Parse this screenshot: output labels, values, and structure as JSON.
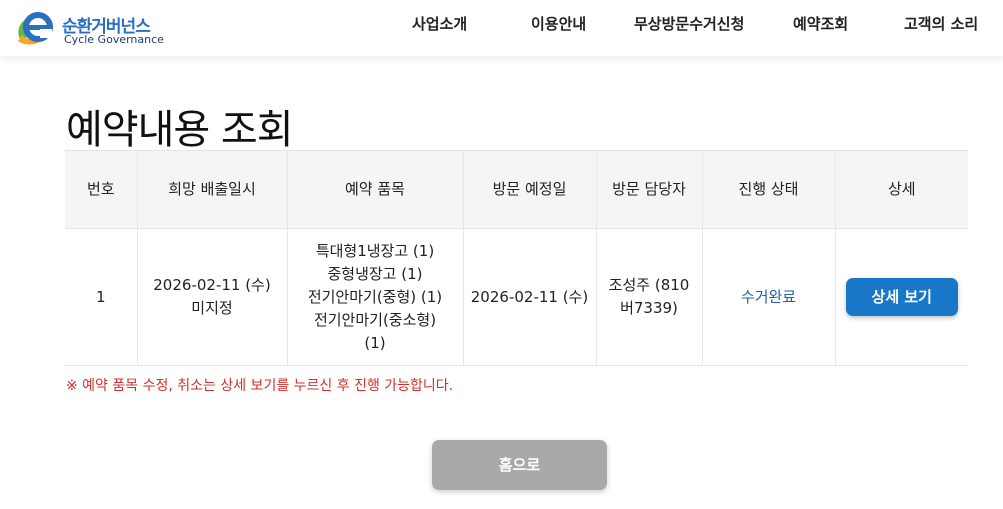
{
  "brand": {
    "name_ko": "순환거버넌스",
    "name_en": "Cycle Governance",
    "logo_icon": "e-leaf-logo-icon",
    "colors": {
      "blue": "#2a6fc0",
      "green": "#5cb84a",
      "orange": "#f5a623"
    }
  },
  "nav": {
    "items": [
      "사업소개",
      "이용안내",
      "무상방문수거신청",
      "예약조회",
      "고객의 소리"
    ]
  },
  "page": {
    "title": "예약내용 조회"
  },
  "table": {
    "headers": [
      "번호",
      "희망 배출일시",
      "예약 품목",
      "방문 예정일",
      "방문 담당자",
      "진행 상태",
      "상세"
    ],
    "rows": [
      {
        "no": "1",
        "desired_date": "2026-02-11 (수)",
        "desired_time": "미지정",
        "items": [
          "특대형1냉장고 (1)",
          "중형냉장고 (1)",
          "전기안마기(중형) (1)",
          "전기안마기(중소형)",
          "(1)"
        ],
        "visit_date": "2026-02-11 (수)",
        "staff": "조성주 (810버7339)",
        "status": "수거완료",
        "detail_label": "상세 보기"
      }
    ]
  },
  "notice": "※ 예약 품목 수정, 취소는 상세 보기를 누르신 후 진행 가능합니다.",
  "home_button": "홈으로",
  "theme": {
    "accent": "#1877c9",
    "status_color": "#1f5fa8",
    "notice_color": "#d32f2f",
    "home_button_bg": "#a9a9a9"
  }
}
